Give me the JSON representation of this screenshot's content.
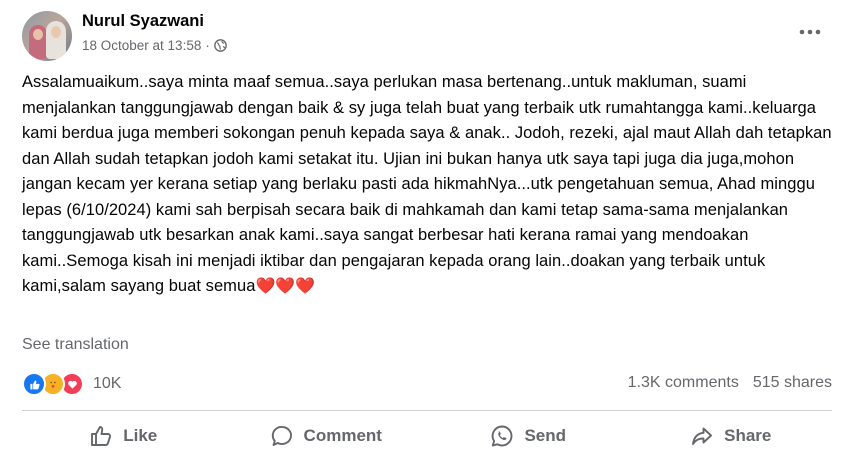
{
  "post": {
    "author": "Nurul Syazwani",
    "timestamp": "18 October at 13:58",
    "separator": "·",
    "text": "Assalamuaikum..saya minta maaf semua..saya perlukan masa bertenang..untuk makluman, suami menjalankan tanggungjawab dengan baik & sy juga telah buat yang terbaik utk rumahtangga kami..keluarga kami berdua juga memberi sokongan penuh kepada saya & anak.. Jodoh, rezeki, ajal maut Allah dah tetapkan dan Allah sudah tetapkan jodoh kami setakat itu. Ujian ini bukan hanya utk saya tapi juga dia juga,mohon jangan kecam yer kerana setiap yang berlaku pasti ada hikmahNya...utk pengetahuan semua, Ahad minggu lepas (6/10/2024) kami sah berpisah secara baik di mahkamah dan kami tetap sama-sama menjalankan tanggungjawab utk besarkan anak kami..saya sangat berbesar hati kerana ramai yang mendoakan kami..Semoga kisah ini menjadi iktibar dan pengajaran kepada orang lain..doakan yang terbaik untuk kami,salam sayang buat semua",
    "emoji": "❤️❤️❤️",
    "see_translation": "See translation",
    "audience_icon": "globe-icon"
  },
  "engagement": {
    "reactions_count": "10K",
    "reaction_icons": [
      "like-icon",
      "care-icon",
      "love-icon"
    ],
    "comments": "1.3K comments",
    "shares": "515 shares"
  },
  "actions": {
    "like": "Like",
    "comment": "Comment",
    "send": "Send",
    "share": "Share"
  },
  "colors": {
    "secondary_text": "#65676b",
    "like_blue": "#1877f2",
    "love_red": "#f33e58",
    "care_yellow": "#f7b125",
    "divider": "#ced0d4"
  }
}
